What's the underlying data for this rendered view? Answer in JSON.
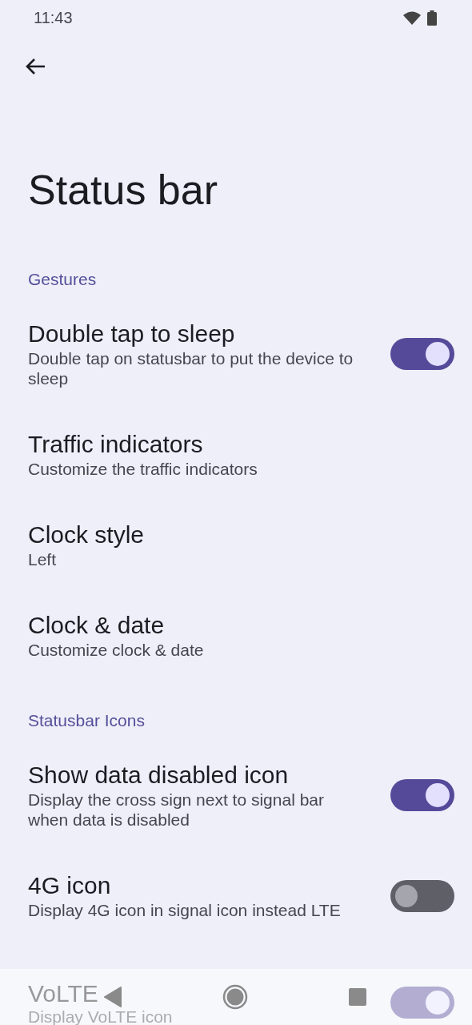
{
  "status_bar": {
    "time": "11:43"
  },
  "page_title": "Status bar",
  "sections": [
    {
      "header": "Gestures",
      "items": [
        {
          "kind": "switch",
          "title": "Double tap to sleep",
          "summary": "Double tap on statusbar to put the device to sleep",
          "on": true
        },
        {
          "kind": "link",
          "title": "Traffic indicators",
          "summary": "Customize the traffic indicators"
        },
        {
          "kind": "link",
          "title": "Clock style",
          "summary": "Left"
        },
        {
          "kind": "link",
          "title": "Clock & date",
          "summary": "Customize clock & date"
        }
      ]
    },
    {
      "header": "Statusbar Icons",
      "items": [
        {
          "kind": "switch",
          "title": "Show data disabled icon",
          "summary": "Display the cross sign next to signal bar when data is disabled",
          "on": true
        },
        {
          "kind": "switch",
          "title": "4G icon",
          "summary": "Display 4G icon in signal icon instead LTE",
          "on": false
        },
        {
          "kind": "switch",
          "title": "VoLTE",
          "summary": "Display VoLTE icon",
          "on": true
        }
      ]
    }
  ]
}
